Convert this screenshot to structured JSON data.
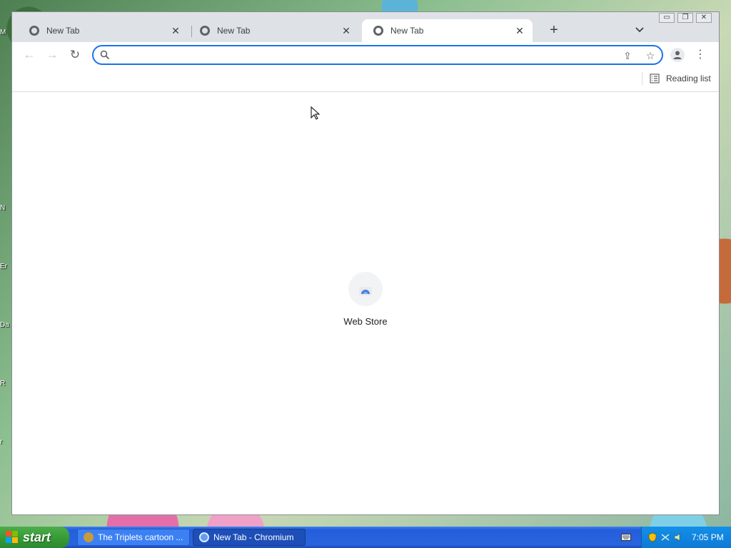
{
  "desktop": {
    "labels": [
      "M",
      "N",
      "Er",
      "Da",
      "R",
      "r"
    ]
  },
  "window": {
    "controls": {
      "minimize": "▭",
      "maximize": "❐",
      "close": "✕"
    },
    "tabs": [
      {
        "title": "New Tab",
        "active": false
      },
      {
        "title": "New Tab",
        "active": false
      },
      {
        "title": "New Tab",
        "active": true
      }
    ],
    "new_tab_symbol": "+",
    "tab_search_symbol": "⌄"
  },
  "toolbar": {
    "back": "←",
    "forward": "→",
    "reload": "↻",
    "omnibox_value": "",
    "omnibox_placeholder": "",
    "share": "⇪",
    "bookmark_star": "☆",
    "menu": "⋮"
  },
  "bookmarks_bar": {
    "reading_list_label": "Reading list"
  },
  "content": {
    "shortcut_label": "Web Store"
  },
  "taskbar": {
    "start_label": "start",
    "items": [
      {
        "label": "The Triplets cartoon ...",
        "active": false
      },
      {
        "label": "New Tab - Chromium",
        "active": true
      }
    ],
    "clock": "7:05 PM"
  },
  "colors": {
    "accent": "#1a73e8",
    "tabstrip": "#dee1e6",
    "taskbar": "#245edb",
    "start": "#379b37"
  }
}
